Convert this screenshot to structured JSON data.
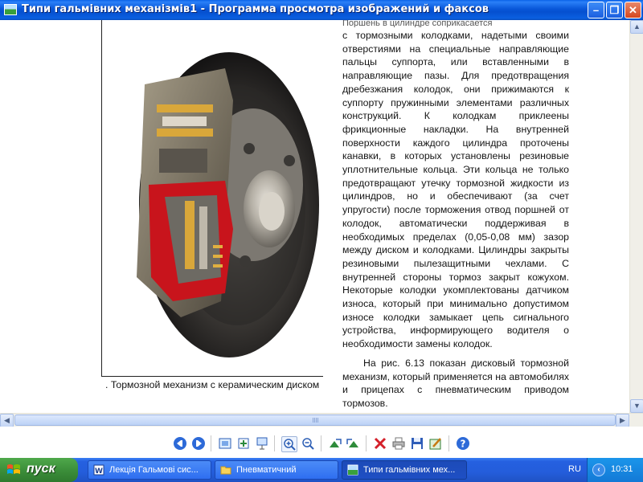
{
  "window": {
    "title": "Типи гальмівних механізмів1 - Программа просмотра изображений и факсов",
    "minimize_glyph": "–",
    "maximize_glyph": "❐",
    "close_glyph": "✕"
  },
  "document": {
    "top_fragment": "Поршень в цилиндре соприкасается",
    "paragraph1": "с тормозными колодками, надетыми своими отверстиями на специальные направляющие пальцы суппорта, или вставленными в направляющие пазы. Для предотвращения дребезжания колодок, они прижимаются к суппорту пружинными элементами различных конструкций. К колодкам приклеены фрикционные накладки. На внутренней поверхности каждого цилиндра проточены канавки, в которых установлены резиновые уплотнительные кольца. Эти кольца не только предотвращают утечку тормозной жидкости из цилиндров, но и обеспечивают (за счет упругости) после торможения отвод поршней от колодок, автоматически поддерживая в необходимых пределах (0,05-0,08 мм) зазор между диском и колодками. Цилиндры закрыты резиновыми пылезащитными чехлами. С внутренней стороны тормоз закрыт кожухом. Некоторые колодки укомплектованы датчиком износа, который при минимально допустимом износе колодки замыкает цепь сигнального устройства, информирующего водителя о необходимости замены колодок.",
    "paragraph2": "На рис. 6.13 показан дисковый тормозной механизм, который применяется на автомобилях и прицепах с пневматическим приводом тормозов.",
    "caption": ". Тормозной механизм с керамическим диском"
  },
  "toolbar": {
    "icons": [
      "previous-image-icon",
      "next-image-icon",
      "best-fit-icon",
      "actual-size-icon",
      "slideshow-icon",
      "zoom-in-icon",
      "zoom-out-icon",
      "rotate-clockwise-icon",
      "rotate-counterclockwise-icon",
      "delete-icon",
      "print-icon",
      "save-icon",
      "edit-icon",
      "help-icon"
    ]
  },
  "taskbar": {
    "start_label": "пуск",
    "tasks": [
      {
        "label": "Лекція Гальмові сис...",
        "icon": "word-document-icon"
      },
      {
        "label": "Пневматичний",
        "icon": "folder-icon"
      },
      {
        "label": "Типи гальмівних мех...",
        "icon": "image-viewer-icon"
      }
    ],
    "language": "RU",
    "clock": "10:31"
  },
  "colors": {
    "titlebar": "#0550d0",
    "taskbar": "#245ddb",
    "start_button": "#3c8f3a",
    "tray": "#1379d6",
    "brake_red": "#c8141c"
  }
}
